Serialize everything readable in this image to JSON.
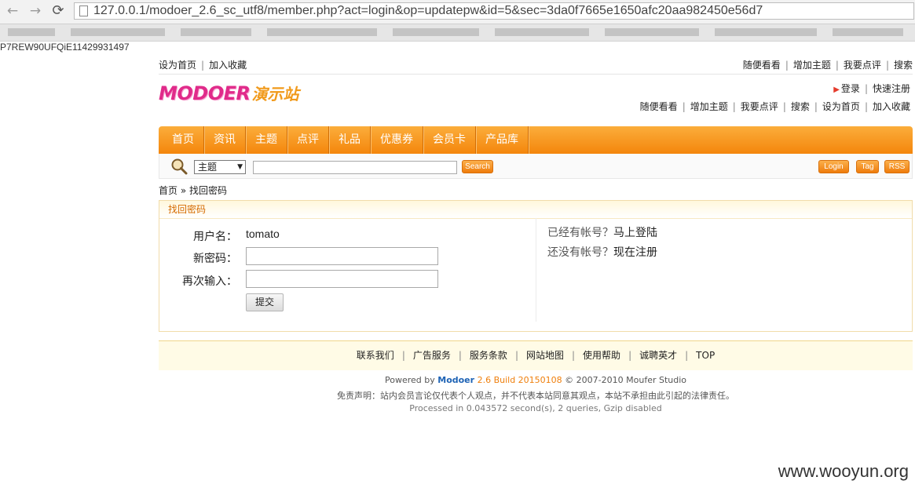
{
  "browser": {
    "url": "127.0.0.1/modoer_2.6_sc_utf8/member.php?act=login&op=updatepw&id=5&sec=3da0f7665e1650afc20aa982450e56d7",
    "back_icon": "arrow-left-icon",
    "forward_icon": "arrow-right-icon",
    "reload_icon": "reload-icon",
    "overflow_text": "P7REW90UFQiE11429931497"
  },
  "topbar": {
    "left": [
      "设为首页",
      "加入收藏"
    ],
    "right": [
      "随便看看",
      "增加主题",
      "我要点评",
      "搜索"
    ]
  },
  "header": {
    "logo_en": "MODOER",
    "logo_cn": "演示站",
    "login": "登录",
    "register": "快速注册",
    "links": [
      "随便看看",
      "增加主题",
      "我要点评",
      "搜索",
      "设为首页",
      "加入收藏"
    ]
  },
  "menu": [
    "首页",
    "资讯",
    "主题",
    "点评",
    "礼品",
    "优惠券",
    "会员卡",
    "产品库"
  ],
  "search": {
    "select_value": "主题",
    "button": "Search",
    "right_buttons": [
      "Login",
      "Tag",
      "RSS"
    ]
  },
  "breadcrumb": {
    "home": "首页",
    "sep": "»",
    "current": "找回密码"
  },
  "form": {
    "title": "找回密码",
    "username_label": "用户名：",
    "username_value": "tomato",
    "newpw_label": "新密码：",
    "repeat_label": "再次输入：",
    "submit": "提交",
    "side_q1": "已经有帐号？",
    "side_a1": "马上登陆",
    "side_q2": "还没有帐号？",
    "side_a2": "现在注册"
  },
  "footer": {
    "links": [
      "联系我们",
      "广告服务",
      "服务条款",
      "网站地图",
      "使用帮助",
      "诚聘英才",
      "TOP"
    ],
    "powered_prefix": "Powered by",
    "brand": "Modoer",
    "version": "2.6 Build 20150108",
    "copyright": "© 2007-2010 Moufer Studio",
    "disclaimer": "免责声明：站内会员言论仅代表个人观点，并不代表本站同意其观点，本站不承担由此引起的法律责任。",
    "processed": "Processed in 0.043572 second(s), 2 queries, Gzip disabled"
  },
  "watermark": "www.wooyun.org"
}
